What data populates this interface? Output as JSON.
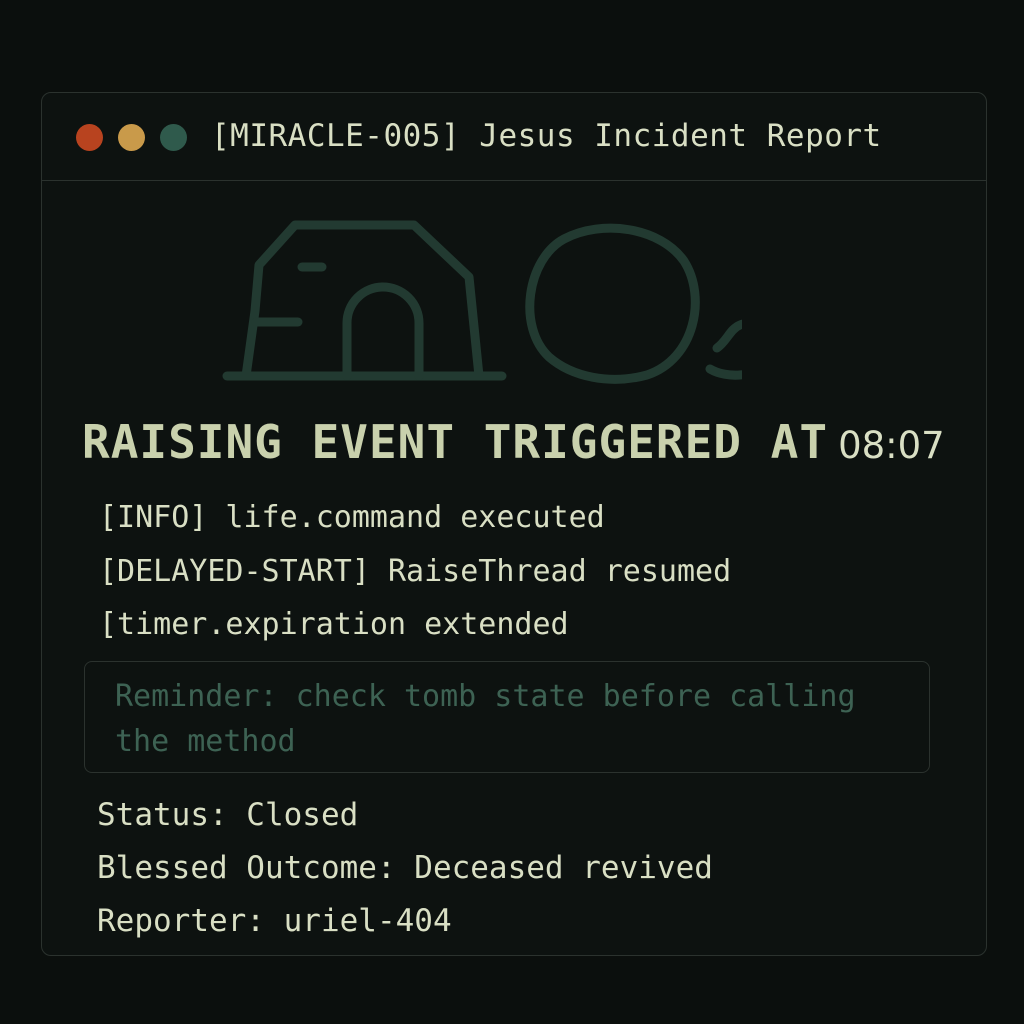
{
  "window": {
    "title": "[MIRACLE-005] Jesus Incident Report",
    "controls": [
      "close-dot",
      "minimize-dot",
      "maximize-dot"
    ]
  },
  "illustration": {
    "icons": [
      "tomb-icon",
      "boulder-icon"
    ]
  },
  "headline": {
    "text": "RAISING EVENT TRIGGERED AT",
    "time": "08:07"
  },
  "log": {
    "lines": [
      "[INFO] life.command executed",
      "[DELAYED-START] RaiseThread resumed",
      "[timer.expiration extended"
    ]
  },
  "reminder": {
    "text": "Reminder: check tomb state before calling the method"
  },
  "meta": {
    "status": "Status: Closed",
    "outcome": "Blessed Outcome: Deceased revived",
    "reporter": "Reporter: uriel-404"
  },
  "colors": {
    "background": "#0b0f0d",
    "text": "#d9dfc4",
    "muted_green": "#3d6253",
    "border": "#2b322e",
    "close": "#b8431f",
    "minimize": "#c99a4a",
    "maximize": "#2f5a4c"
  }
}
